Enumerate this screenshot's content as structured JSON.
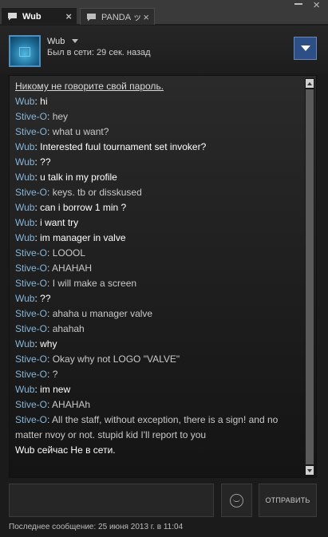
{
  "tabs": [
    {
      "label": "Wub",
      "close": "×"
    },
    {
      "label": "PANDA ッ",
      "close": "×"
    }
  ],
  "window": {
    "minimize_icon": "minimize-icon",
    "close": "×"
  },
  "header": {
    "username": "Wub",
    "status": "Был в сети: 29 сек. назад"
  },
  "chat": {
    "warning": "Никому не говорите свой пароль.",
    "messages": [
      {
        "speaker": "Wub",
        "text": "hi"
      },
      {
        "speaker": "Stive-O",
        "text": "hey"
      },
      {
        "speaker": "Stive-O",
        "text": "what u want?"
      },
      {
        "speaker": "Wub",
        "text": "Interested fuul tournament set invoker?"
      },
      {
        "speaker": "Wub",
        "text": "??"
      },
      {
        "speaker": "Wub",
        "text": "u talk in my profile"
      },
      {
        "speaker": "Stive-O",
        "text": "keys. tb or disskused"
      },
      {
        "speaker": "Wub",
        "text": "can i borrow 1 min ?"
      },
      {
        "speaker": "Wub",
        "text": "i want try"
      },
      {
        "speaker": "Wub",
        "text": "im manager in valve"
      },
      {
        "speaker": "Stive-O",
        "text": "LOOOL"
      },
      {
        "speaker": "Stive-O",
        "text": "AHAHAH"
      },
      {
        "speaker": "Stive-O",
        "text": "I will make a screen"
      },
      {
        "speaker": "Wub",
        "text": "??"
      },
      {
        "speaker": "Stive-O",
        "text": "ahaha u manager valve"
      },
      {
        "speaker": "Stive-O",
        "text": "ahahah"
      },
      {
        "speaker": "Wub",
        "text": "why"
      },
      {
        "speaker": "Stive-O",
        "text": "Okay why not LOGO \"VALVE\""
      },
      {
        "speaker": "Stive-O",
        "text": "?"
      },
      {
        "speaker": "Wub",
        "text": "im new"
      },
      {
        "speaker": "Stive-O",
        "text": "AHAHAh"
      },
      {
        "speaker": "Stive-O",
        "text": "All the staff, without exception, there is a sign! and no matter nvoy or not. stupid kid I'll report to you"
      }
    ],
    "offline_notice": "Wub сейчас Не в сети."
  },
  "input": {
    "placeholder": "",
    "send_label": "ОТПРАВИТЬ"
  },
  "footer": {
    "last_message": "Последнее сообщение: 25 июня 2013 г. в 11:04"
  },
  "colors": {
    "speaker_name": "#86b5d9",
    "wub_text": "#ffffff",
    "stive_text": "#c9c9c9",
    "menu_button": "#2d4f87"
  }
}
